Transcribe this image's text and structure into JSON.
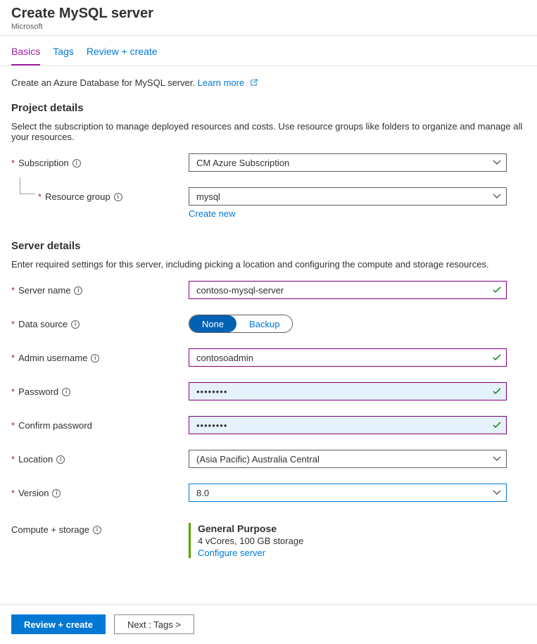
{
  "header": {
    "title": "Create MySQL server",
    "subtitle": "Microsoft"
  },
  "tabs": {
    "basics": "Basics",
    "tags": "Tags",
    "review": "Review + create"
  },
  "intro": {
    "text": "Create an Azure Database for MySQL server. ",
    "learn_more": "Learn more"
  },
  "project": {
    "title": "Project details",
    "desc": "Select the subscription to manage deployed resources and costs. Use resource groups like folders to organize and manage all your resources.",
    "subscription_label": "Subscription",
    "subscription_value": "CM Azure Subscription",
    "resource_group_label": "Resource group",
    "resource_group_value": "mysql",
    "create_new": "Create new"
  },
  "server": {
    "title": "Server details",
    "desc": "Enter required settings for this server, including picking a location and configuring the compute and storage resources.",
    "server_name_label": "Server name",
    "server_name_value": "contoso-mysql-server",
    "data_source_label": "Data source",
    "data_source_none": "None",
    "data_source_backup": "Backup",
    "admin_user_label": "Admin username",
    "admin_user_value": "contosoadmin",
    "password_label": "Password",
    "password_value": "••••••••",
    "confirm_label": "Confirm password",
    "confirm_value": "••••••••",
    "location_label": "Location",
    "location_value": "(Asia Pacific) Australia Central",
    "version_label": "Version",
    "version_value": "8.0",
    "compute_label": "Compute + storage",
    "compute_title": "General Purpose",
    "compute_detail": "4 vCores, 100 GB storage",
    "configure_server": "Configure server"
  },
  "footer": {
    "review": "Review + create",
    "next": "Next : Tags >"
  }
}
